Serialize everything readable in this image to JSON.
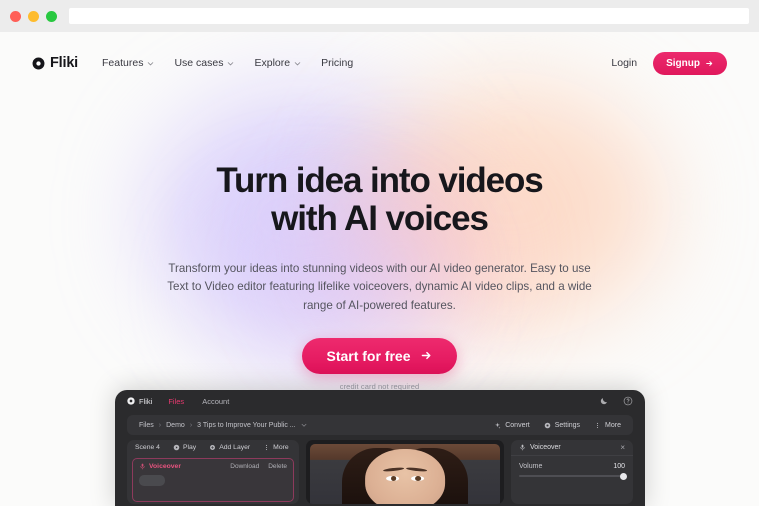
{
  "browser": {
    "url_value": "",
    "url_placeholder": "",
    "traffic_lights": [
      "close",
      "minimize",
      "maximize"
    ]
  },
  "nav": {
    "brand": "Fliki",
    "links": [
      {
        "label": "Features",
        "has_dropdown": true
      },
      {
        "label": "Use cases",
        "has_dropdown": true
      },
      {
        "label": "Explore",
        "has_dropdown": true
      },
      {
        "label": "Pricing",
        "has_dropdown": false
      }
    ],
    "login_label": "Login",
    "signup_label": "Signup"
  },
  "hero": {
    "title_line1": "Turn idea into videos",
    "title_line2": "with AI voices",
    "subtitle": "Transform your ideas into stunning videos with our AI video generator. Easy to use Text to Video editor featuring lifelike voiceovers, dynamic AI video clips, and a wide range of AI-powered features.",
    "cta_label": "Start for free",
    "cta_note": "credit card not required"
  },
  "app": {
    "brand": "Fliki",
    "tabs": [
      {
        "label": "Files",
        "active": true
      },
      {
        "label": "Account",
        "active": false
      }
    ],
    "breadcrumb": [
      "Files",
      "Demo",
      "3 Tips to Improve Your Public ..."
    ],
    "breadcrumb_separator": "›",
    "toolbar": [
      {
        "label": "Convert",
        "icon": "sparkle-icon"
      },
      {
        "label": "Settings",
        "icon": "gear-icon"
      },
      {
        "label": "More",
        "icon": "kebab-icon"
      }
    ],
    "topbar_icons": [
      {
        "name": "dark-mode-icon"
      },
      {
        "name": "help-icon"
      }
    ],
    "scene": {
      "label": "Scene 4",
      "tools": [
        {
          "label": "Play",
          "icon": "play-icon"
        },
        {
          "label": "Add Layer",
          "icon": "add-layer-icon"
        },
        {
          "label": "More",
          "icon": "kebab-icon"
        }
      ]
    },
    "voiceover_layer": {
      "title": "Voiceover",
      "actions": [
        "Download",
        "Delete"
      ]
    },
    "right_panel": {
      "title": "Voiceover",
      "close": "×",
      "rows": [
        {
          "label": "Volume",
          "value": "100"
        }
      ]
    }
  },
  "colors": {
    "accent_pink": "#e0125a",
    "page_bg": "#fbfbfa",
    "app_dark": "#2b2b2d",
    "text_dark": "#17171c"
  }
}
